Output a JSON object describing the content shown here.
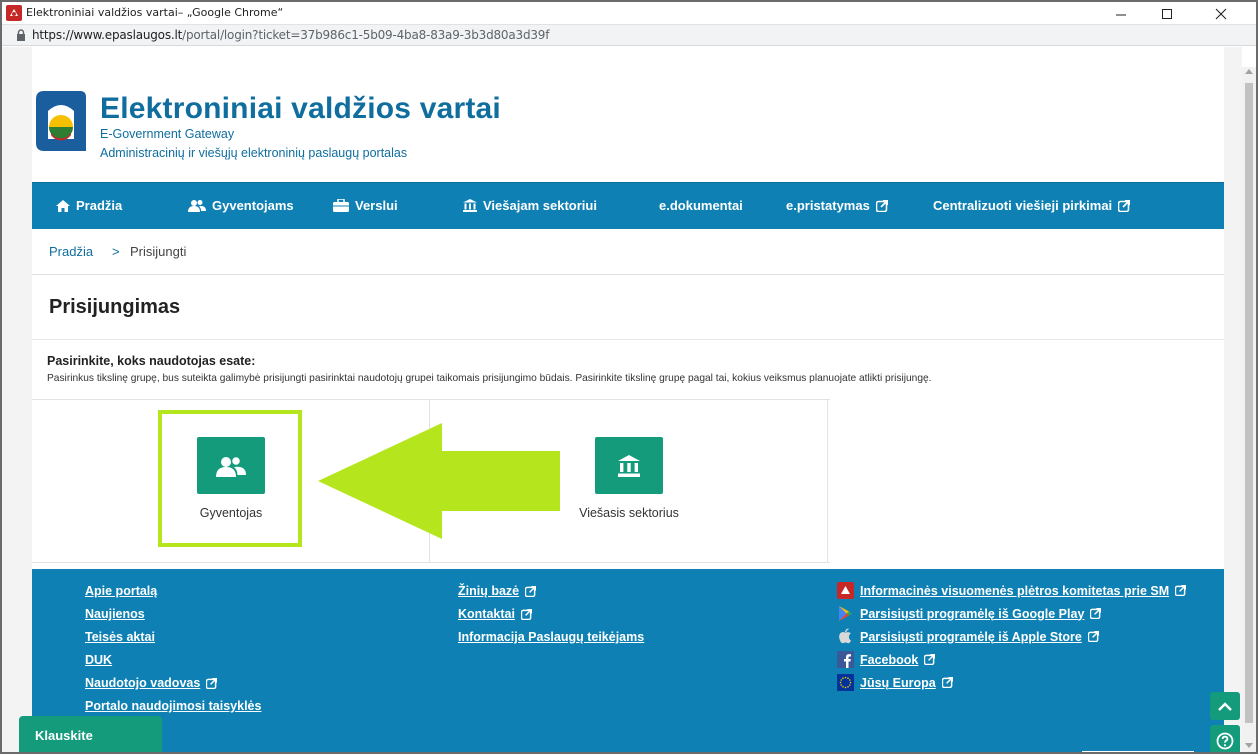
{
  "window": {
    "title": "Elektroniniai valdžios vartai– „Google Chrome“",
    "url_host": "https://www.epaslaugos.lt",
    "url_path": "/portal/login?ticket=37b986c1-5b09-4ba8-83a9-3b3d80a3d39f"
  },
  "brand": {
    "name": "Elektroniniai valdžios vartai",
    "subtitle_en": "E-Government Gateway",
    "subtitle_lt": "Administracinių ir viešųjų elektroninių paslaugų portalas"
  },
  "nav": {
    "items": [
      {
        "label": "Pradžia",
        "icon": "home-icon"
      },
      {
        "label": "Gyventojams",
        "icon": "people-icon"
      },
      {
        "label": "Verslui",
        "icon": "briefcase-icon"
      },
      {
        "label": "Viešajam sektoriui",
        "icon": "institution-icon"
      },
      {
        "label": "e.dokumentai",
        "icon": ""
      },
      {
        "label": "e.pristatymas",
        "icon": "external-link-icon"
      },
      {
        "label": "Centralizuoti viešieji pirkimai",
        "icon": "external-link-icon"
      }
    ]
  },
  "breadcrumb": {
    "home": "Pradžia",
    "separator": ">",
    "current": "Prisijungti"
  },
  "page": {
    "title": "Prisijungimas",
    "choose_title": "Pasirinkite, koks naudotojas esate:",
    "choose_desc": "Pasirinkus tikslinę grupę, bus suteikta galimybė prisijungti pasirinktai naudotojų grupei taikomais prisijungimo būdais. Pasirinkite tikslinę grupę pagal tai, kokius veiksmus planuojate atlikti prisijungę."
  },
  "options": [
    {
      "label": "Gyventojas",
      "icon": "people-icon"
    },
    {
      "label": "Viešasis sektorius",
      "icon": "institution-icon"
    }
  ],
  "footer": {
    "col1": [
      "Apie portalą",
      "Naujienos",
      "Teisės aktai",
      "DUK",
      "Naudotojo vadovas",
      "Portalo naudojimosi taisyklės"
    ],
    "col2": [
      "Žinių bazė",
      "Kontaktai",
      "Informacija Paslaugų teikėjams"
    ],
    "col3": [
      "Informacinės visuomenės plėtros komitetas prie SM",
      "Parsisiųsti programėlę iš Google Play",
      "Parsisiųsti programėlę iš Apple Store",
      "Facebook",
      "Jūsų Europa"
    ]
  },
  "widgets": {
    "ask": "Klauskite"
  },
  "colors": {
    "brand_blue": "#0e80b3",
    "tile_green": "#149b7b",
    "highlight_lime": "#b5e61d"
  }
}
